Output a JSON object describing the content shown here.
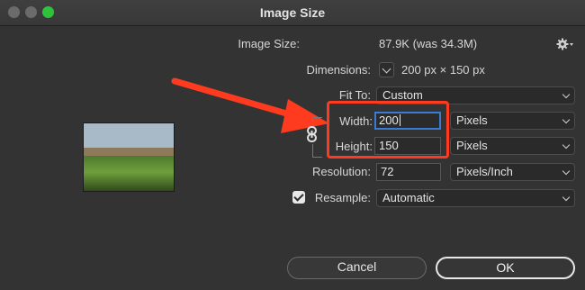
{
  "window": {
    "title": "Image Size"
  },
  "info": {
    "image_size_label": "Image Size:",
    "image_size_value": "87.9K (was 34.3M)",
    "dimensions_label": "Dimensions:",
    "dimensions_value": "200 px  ×  150 px"
  },
  "fit_to": {
    "label": "Fit To:",
    "value": "Custom"
  },
  "width": {
    "label": "Width:",
    "value": "200",
    "unit": "Pixels"
  },
  "height": {
    "label": "Height:",
    "value": "150",
    "unit": "Pixels"
  },
  "resolution": {
    "label": "Resolution:",
    "value": "72",
    "unit": "Pixels/Inch"
  },
  "resample": {
    "label": "Resample:",
    "value": "Automatic",
    "checked": true
  },
  "buttons": {
    "cancel": "Cancel",
    "ok": "OK"
  },
  "icons": {
    "settings": "gear-icon",
    "constrain": "link-icon"
  },
  "colors": {
    "highlight": "#ff3b1f",
    "focus": "#3a7bd5",
    "zoom": "#2fc33c"
  }
}
